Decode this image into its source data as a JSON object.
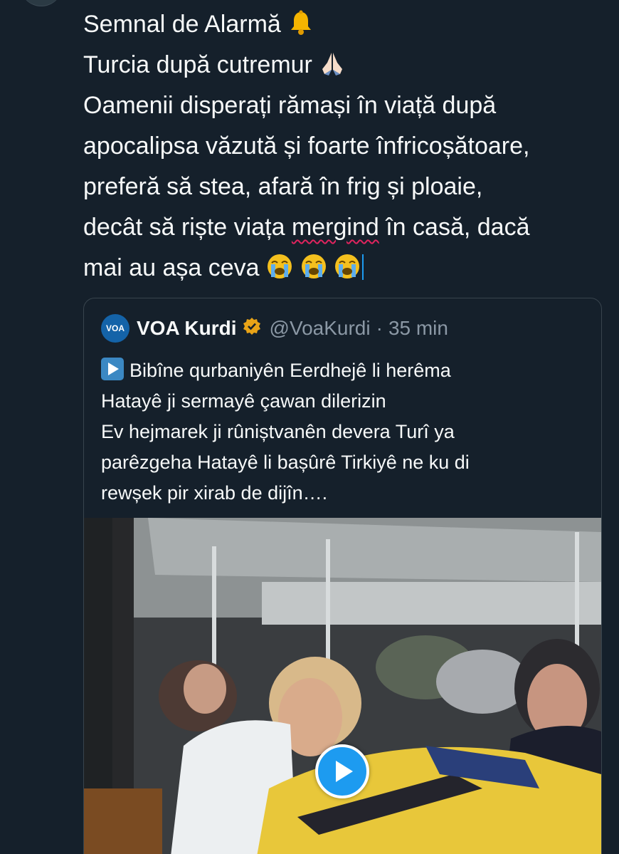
{
  "tweet": {
    "lines": [
      "Semnal de Alarmă",
      "Turcia după cutremur",
      "Oamenii disperați rămași în viață după",
      "apocalipsa văzută și foarte înfricoșătoare,",
      "preferă să stea, afară în frig și ploaie,",
      "decât să riște viața",
      "mergind",
      "în casă, dacă",
      "mai au așa ceva"
    ],
    "emoji_icons": [
      "bell-icon",
      "folded-hands-icon",
      "loudly-crying-face-icon"
    ]
  },
  "quote": {
    "logo_text": "VOA",
    "name": "VOA Kurdi",
    "handle": "@VoaKurdi",
    "separator": "·",
    "time": "35 min",
    "text_lines": [
      "Bibîne qurbaniyên Eerdhejê li herêma",
      "Hatayê ji sermayê çawan dilerizin",
      "Ev hejmarek ji rûniștvanên devera Turî ya",
      "parêzgeha Hatayê li bașûrê Tirkiyê ne ku di",
      "rewșek pir xirab de dijîn…."
    ],
    "media": {
      "type": "video",
      "icon": "play-icon"
    }
  },
  "colors": {
    "background": "#15202b",
    "text": "#f7f9f9",
    "secondary_text": "#8b98a5",
    "border": "#38444d",
    "accent": "#1d9bf0",
    "spellcheck": "#e0245e",
    "verified_badge": "#e8a317"
  }
}
